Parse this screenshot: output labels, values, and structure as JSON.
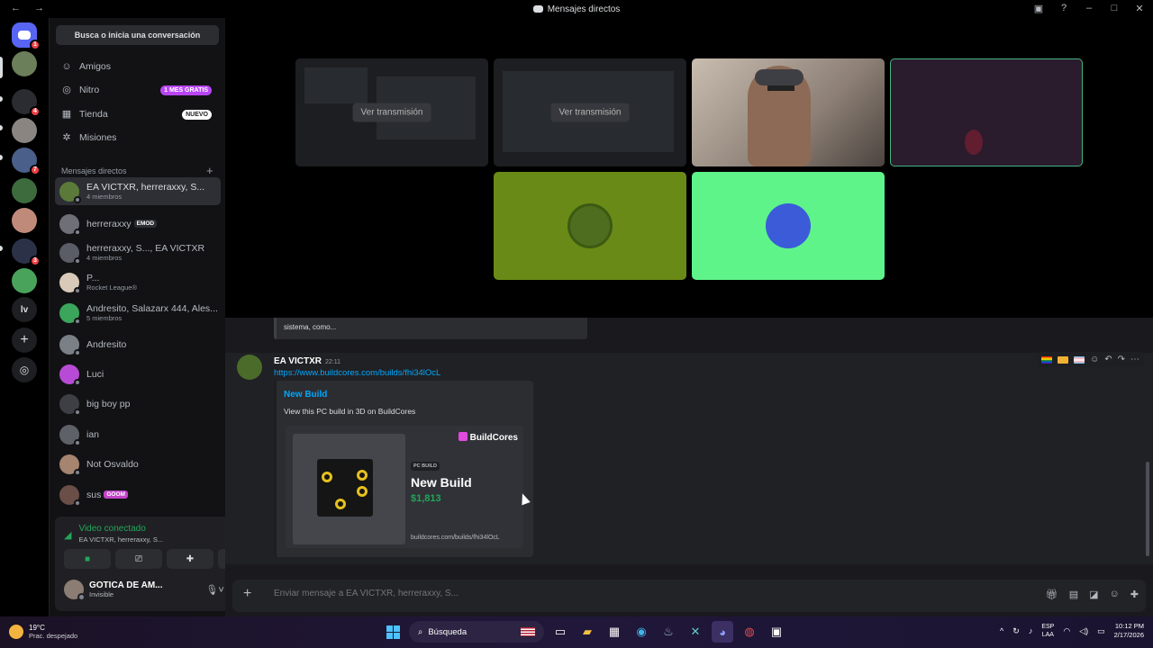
{
  "window": {
    "title": "Mensajes directos",
    "nav_back": "←",
    "nav_fwd": "→"
  },
  "guild_badges": {
    "dm": "1",
    "g3": "4",
    "g5": "7",
    "g8": "3"
  },
  "sidebar": {
    "search": "Busca o inicia una conversación",
    "nav": [
      {
        "label": "Amigos",
        "icon": "friends-icon"
      },
      {
        "label": "Nitro",
        "icon": "nitro-icon",
        "pill": "1 MES GRATIS"
      },
      {
        "label": "Tienda",
        "icon": "shop-icon",
        "pill": "NUEVO"
      },
      {
        "label": "Misiones",
        "icon": "quests-icon"
      }
    ],
    "dm_header": "Mensajes directos",
    "dms": [
      {
        "name": "EA VICTXR, herreraxxy, S...",
        "sub": "4 miembros",
        "color": "#5b7a3a"
      },
      {
        "name": "herreraxxy",
        "tag": "EMOD",
        "color": "#6f6f78"
      },
      {
        "name": "herreraxxy, S..., EA VICTXR",
        "sub": "4 miembros",
        "color": "#5a5d66"
      },
      {
        "name": "P...",
        "sub": "Rocket League®",
        "color": "#d9c9b8"
      },
      {
        "name": "Andresito, Salazarx 444, Ales...",
        "sub": "5 miembros",
        "color": "#3ba55c"
      },
      {
        "name": "Andresito",
        "color": "#7b7f86"
      },
      {
        "name": "Luci",
        "color": "#b84bd6"
      },
      {
        "name": "big boy pp",
        "color": "#3d3f44"
      },
      {
        "name": "ian",
        "color": "#5e6168"
      },
      {
        "name": "Not Osvaldo",
        "color": "#a58470"
      },
      {
        "name": "sus",
        "tag": "GOOM",
        "color": "#6a4e48"
      }
    ]
  },
  "voice": {
    "status": "Video conectado",
    "channel": "EA VICTXR, herreraxxy, S...",
    "user_name": "GOTICA DE AM...",
    "user_status": "Invisible"
  },
  "stage": {
    "watch_label": "Ver transmisión"
  },
  "chat": {
    "prev_snippet": "sistema, como...",
    "author": "EA VICTXR",
    "time": "22:11",
    "link": "https://www.buildcores.com/builds/fhi34lOcL",
    "embed_title": "New Build",
    "embed_desc": "View this PC build in 3D on BuildCores",
    "brand": "BuildCores",
    "tag": "PC BUILD",
    "product_title": "New Build",
    "price": "$1,813",
    "card_url": "buildcores.com/builds/fhi34lOcL"
  },
  "composer": {
    "placeholder": "Enviar mensaje a EA VICTXR, herreraxxy, S..."
  },
  "taskbar": {
    "temp": "19°C",
    "weather": "Prac. despejado",
    "search": "Búsqueda",
    "lang1": "ESP",
    "lang2": "LAA",
    "time": "10:12 PM",
    "date": "2/17/2026"
  },
  "colors": {
    "accent": "#5865f2",
    "green": "#23a55a",
    "link": "#00a8fc"
  }
}
